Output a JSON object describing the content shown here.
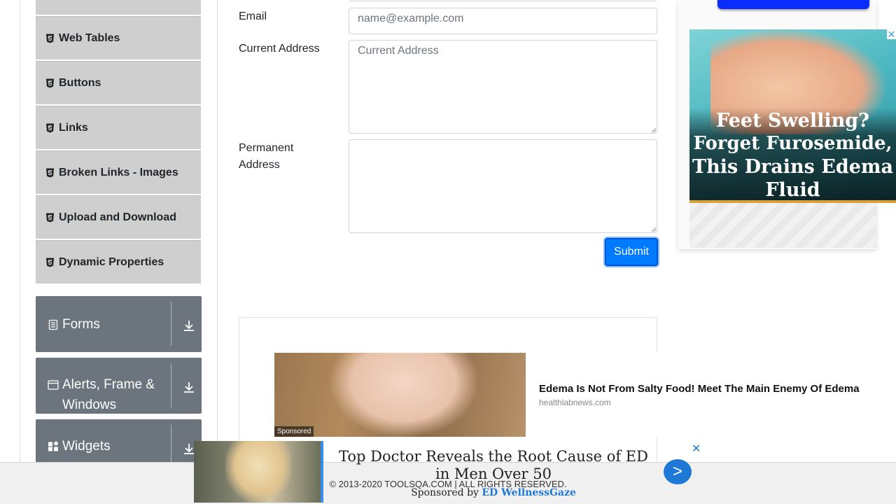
{
  "sidebar": {
    "element_items": [
      {
        "label": "Web Tables",
        "icon": "html5-icon"
      },
      {
        "label": "Buttons",
        "icon": "html5-icon"
      },
      {
        "label": "Links",
        "icon": "html5-icon"
      },
      {
        "label": "Broken Links - Images",
        "icon": "html5-icon"
      },
      {
        "label": "Upload and Download",
        "icon": "html5-icon"
      },
      {
        "label": "Dynamic Properties",
        "icon": "html5-icon"
      }
    ],
    "groups": [
      {
        "label": "Forms",
        "icon": "form-icon"
      },
      {
        "label": "Alerts, Frame & Windows",
        "icon": "window-icon"
      },
      {
        "label": "Widgets",
        "icon": "widgets-icon"
      }
    ]
  },
  "form": {
    "email_label": "Email",
    "email_placeholder": "name@example.com",
    "current_address_label": "Current Address",
    "current_address_placeholder": "Current Address",
    "permanent_address_label": "Permanent Address",
    "submit_label": "Submit"
  },
  "right_ad": {
    "headline": [
      "Feet Swelling?",
      "Forget Furosemide,",
      "This Drains Edema",
      "Fluid"
    ],
    "close": "✕"
  },
  "mid_ad": {
    "sponsored": "Sponsored",
    "title": "Edema Is Not From Salty Food! Meet The Main Enemy Of Edema",
    "source": "healthlabnews.com"
  },
  "bottom_ad": {
    "headline": "Top Doctor Reveals the Root Cause of ED in Men Over 50",
    "sponsored_prefix": "Sponsored by",
    "sponsor": "ED WellnessGaze",
    "go": ">",
    "close": "✕"
  },
  "footer": {
    "copyright": "© 2013-2020 TOOLSQA.COM | ALL RIGHTS RESERVED."
  },
  "colors": {
    "primary": "#007bff",
    "group_bg": "#6c757d",
    "menu_bg": "#cfcfcf"
  }
}
